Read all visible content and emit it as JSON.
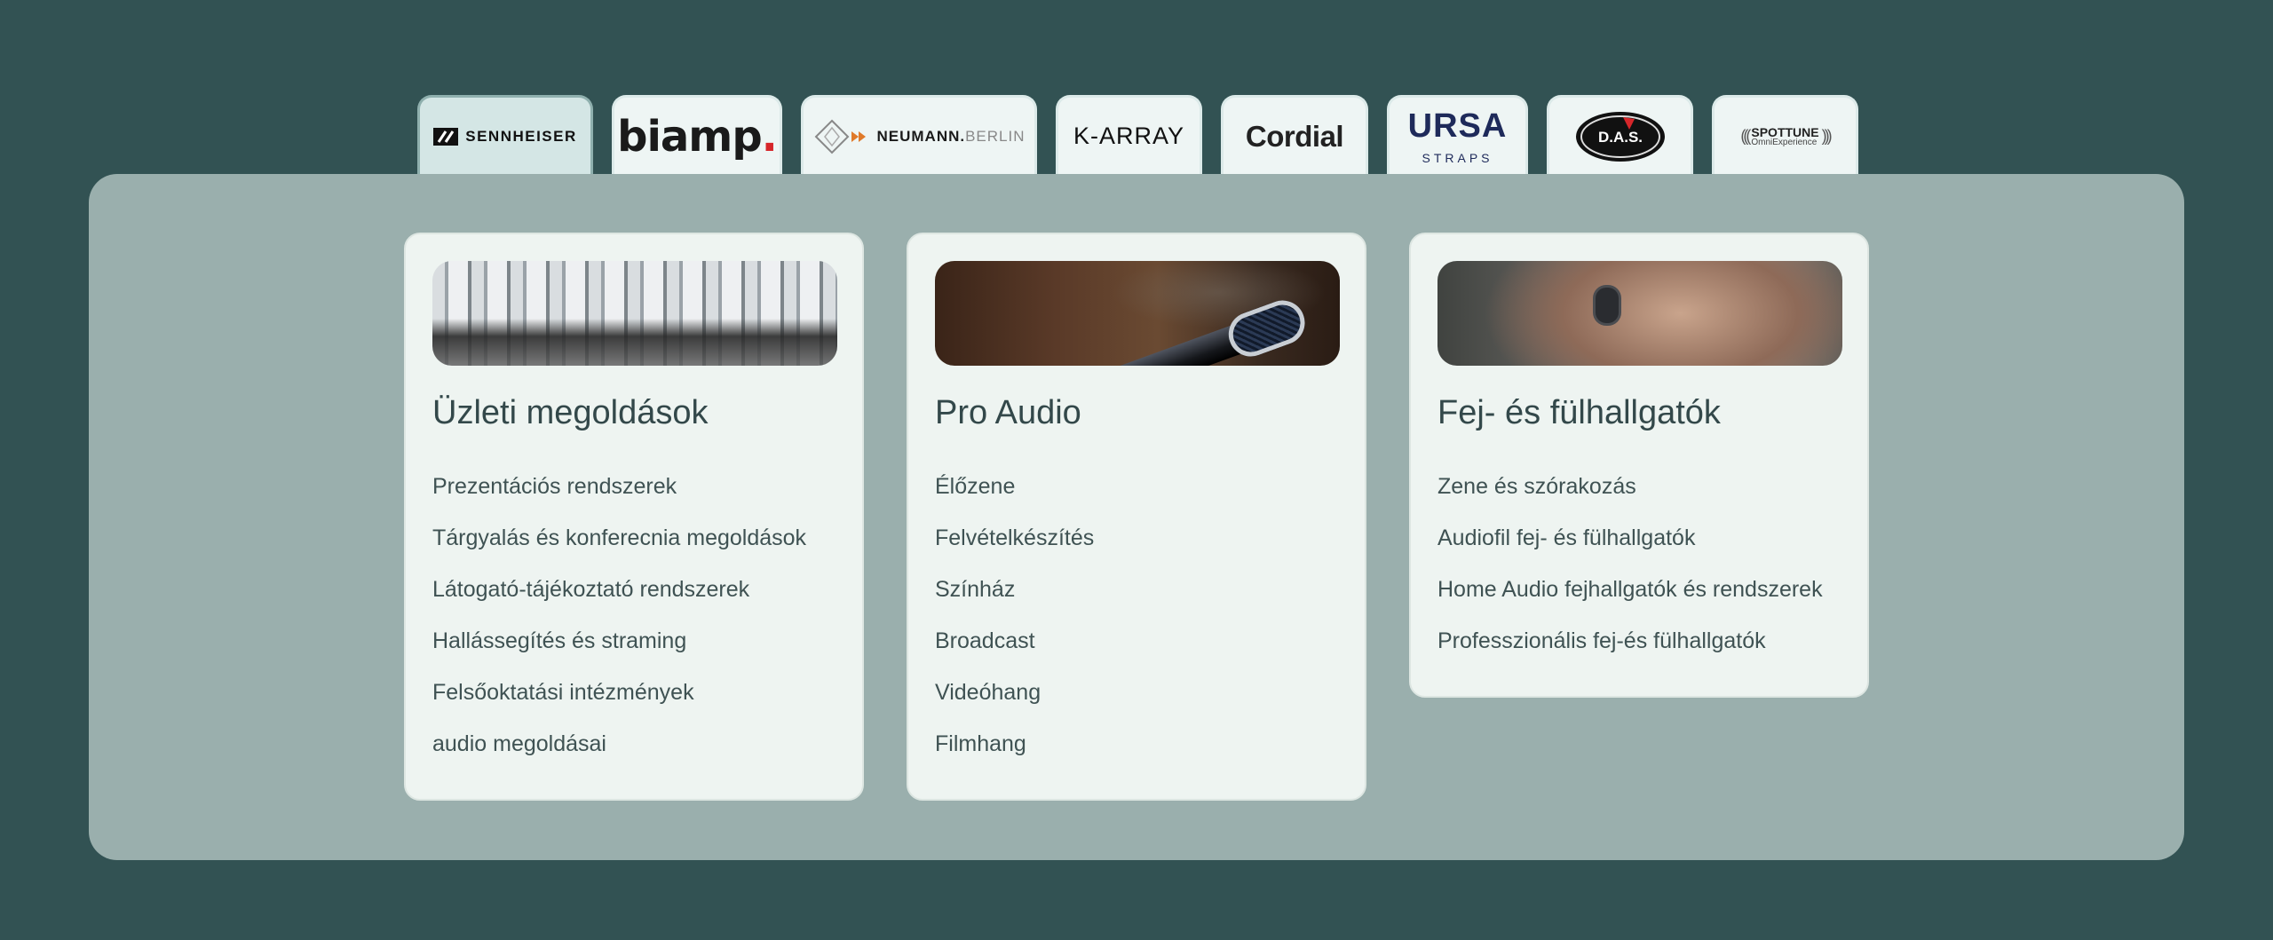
{
  "brands": [
    {
      "id": "sennheiser",
      "name": "SENNHEISER",
      "active": true
    },
    {
      "id": "biamp",
      "name": "biamp",
      "mark": "."
    },
    {
      "id": "neumann",
      "name": "NEUMANN.",
      "sub": "BERLIN"
    },
    {
      "id": "karray",
      "name": "K-ARRAY"
    },
    {
      "id": "cordial",
      "name": "Cordial"
    },
    {
      "id": "ursa",
      "name": "URSA",
      "sub": "STRAPS"
    },
    {
      "id": "das",
      "name": "D.A.S."
    },
    {
      "id": "spottune",
      "name": "SPOTTUNE",
      "sub": "OmniExperience"
    }
  ],
  "cards": [
    {
      "image": "conference-room-microphones",
      "title": "Üzleti megoldások",
      "links": [
        "Prezentációs rendszerek",
        "Tárgyalás és konferecnia megoldások",
        "Látogató-tájékoztató rendszerek",
        "Hallássegítés és straming",
        "Felsőoktatási intézmények",
        "audio megoldásai"
      ]
    },
    {
      "image": "stage-microphone",
      "title": "Pro Audio",
      "links": [
        "Élőzene",
        "Felvételkészítés",
        "Színház",
        "Broadcast",
        "Videóhang",
        "Filmhang"
      ]
    },
    {
      "image": "in-ear-earphone",
      "title": "Fej- és fülhallgatók",
      "links": [
        "Zene és szórakozás",
        "Audiofil fej- és fülhallgatók",
        "Home Audio fejhallgatók és rendszerek",
        "Professzionális fej-és fülhallgatók"
      ]
    }
  ],
  "colors": {
    "background": "#325253",
    "panel": "#9aafad",
    "card": "#eef4f1",
    "tab": "#eef5f4",
    "tab_active": "#d4e6e5",
    "text": "#3f5253"
  }
}
